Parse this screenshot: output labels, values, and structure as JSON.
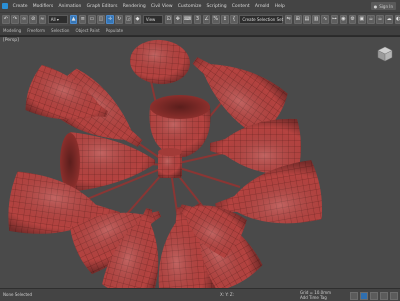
{
  "menubar": {
    "items": [
      "Create",
      "Modifiers",
      "Animation",
      "Graph Editors",
      "Rendering",
      "Civil View",
      "Customize",
      "Scripting",
      "Content",
      "Arnold",
      "Help"
    ],
    "signin": "Sign In"
  },
  "toolbar": {
    "selection_set": "Create Selection Set",
    "view_dropdown": "View"
  },
  "ribbon": {
    "labels": [
      "Modeling",
      "Freeform",
      "Selection",
      "Object Paint",
      "Populate"
    ]
  },
  "viewport": {
    "label": "[Persp]",
    "model": "chandelier-of-glass-cups",
    "mesh_color": "#b54340",
    "wire_color": "#5a1c1a"
  },
  "status": {
    "selection": "None Selected",
    "coords": "X:  Y:  Z:",
    "grid": "Grid = 10.0mm",
    "addtime": "Add Time Tag",
    "auto_key": "Auto",
    "set_key": "Set K."
  }
}
